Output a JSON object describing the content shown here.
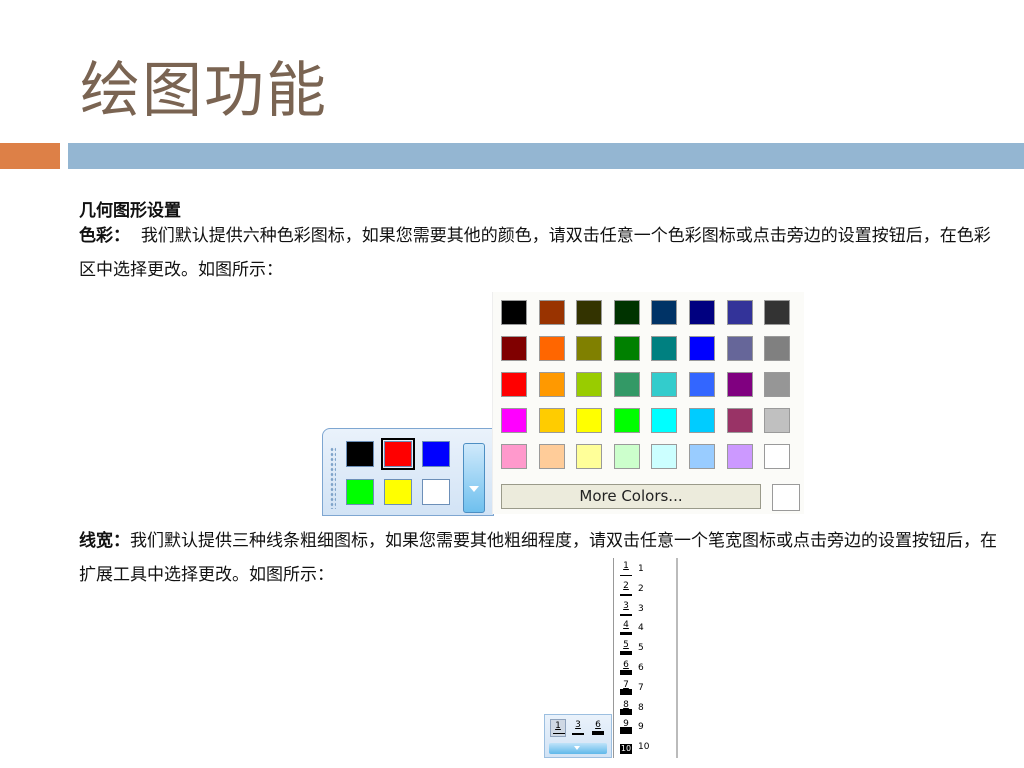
{
  "slide": {
    "title": "绘图功能",
    "accent_orange": "#dd8047",
    "accent_blue": "#94b6d2"
  },
  "content": {
    "heading": "几何图形设置",
    "color_label": "色彩：",
    "color_text": "我们默认提供六种色彩图标，如果您需要其他的颜色，请双击任意一个色彩图标或点击旁边的设置按钮后，在色彩区中选择更改。如图所示：",
    "line_label": "线宽：",
    "line_text": "我们默认提供三种线条粗细图标，如果您需要其他粗细程度，请双击任意一个笔宽图标或点击旁边的设置按钮后，在扩展工具中选择更改。如图所示："
  },
  "color_palette": {
    "defaults": [
      "#000000",
      "#ff0000",
      "#0000ff",
      "#00ff00",
      "#ffff00",
      "#ffffff"
    ],
    "selected_index": 1,
    "grid": [
      [
        "#000000",
        "#993300",
        "#333300",
        "#003300",
        "#003366",
        "#000080",
        "#333399",
        "#333333"
      ],
      [
        "#800000",
        "#ff6600",
        "#808000",
        "#008000",
        "#008080",
        "#0000ff",
        "#666699",
        "#808080"
      ],
      [
        "#ff0000",
        "#ff9900",
        "#99cc00",
        "#339966",
        "#33cccc",
        "#3366ff",
        "#800080",
        "#969696"
      ],
      [
        "#ff00ff",
        "#ffcc00",
        "#ffff00",
        "#00ff00",
        "#00ffff",
        "#00ccff",
        "#993366",
        "#c0c0c0"
      ],
      [
        "#ff99cc",
        "#ffcc99",
        "#ffff99",
        "#ccffcc",
        "#ccffff",
        "#99ccff",
        "#cc99ff",
        "#ffffff"
      ]
    ],
    "more_colors_label": "More Colors..."
  },
  "line_width": {
    "options": [
      "1",
      "2",
      "3",
      "4",
      "5",
      "6",
      "7",
      "8",
      "9",
      "10"
    ],
    "defaults": [
      "1",
      "3",
      "6"
    ],
    "active_index": 0
  }
}
